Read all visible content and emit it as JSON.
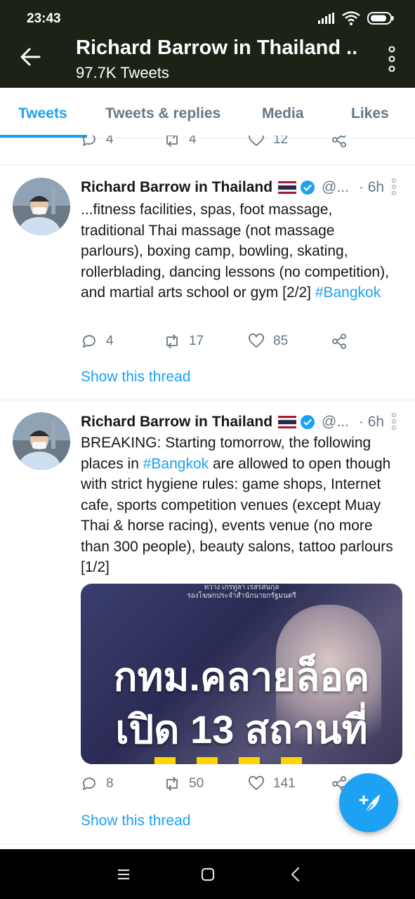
{
  "status_bar": {
    "time": "23:43"
  },
  "header": {
    "title": "Richard Barrow in Thailand ...",
    "subtitle": "97.7K Tweets"
  },
  "tabs": [
    {
      "label": "Tweets",
      "active": true
    },
    {
      "label": "Tweets & replies",
      "active": false
    },
    {
      "label": "Media",
      "active": false
    },
    {
      "label": "Likes",
      "active": false
    }
  ],
  "prev_tweet_actions": {
    "replies": "4",
    "retweets": "4",
    "likes": "12"
  },
  "tweets": [
    {
      "author": "Richard Barrow in Thailand",
      "flag": "thailand-flag-icon",
      "handle": "@...",
      "time": "· 6h",
      "text": "...fitness facilities, spas, foot massage, traditional Thai massage (not massage parlours), boxing camp, bowling, skating, rollerblading, dancing lessons (no competition), and martial arts school or gym [2/2] ",
      "hashtag": "#Bangkok",
      "replies": "4",
      "retweets": "17",
      "likes": "85",
      "show_thread": "Show this thread"
    },
    {
      "author": "Richard Barrow in Thailand",
      "flag": "thailand-flag-icon",
      "handle": "@...",
      "time": "· 6h",
      "text_before": "BREAKING: Starting tomorrow, the following places in ",
      "hashtag": "#Bangkok",
      "text_after": " are allowed to open though with strict hygiene rules: game shops, Internet cafe, sports competition venues (except Muay Thai & horse racing), events venue (no more than 300 people), beauty salons, tattoo parlours [1/2]",
      "media": {
        "small_text": "ทวาง เกรทูลา เรสรสนกุล\nรองโฆษกประจำสำนักนายกรัฐมนตรี",
        "line1": "กทม.คลายล็อค",
        "line2": "เปิด 13 สถานที่"
      },
      "replies": "8",
      "retweets": "50",
      "likes": "141",
      "show_thread": "Show this thread"
    }
  ],
  "colors": {
    "accent": "#1da1f2",
    "header_bg": "#1d2217",
    "muted": "#657786"
  }
}
